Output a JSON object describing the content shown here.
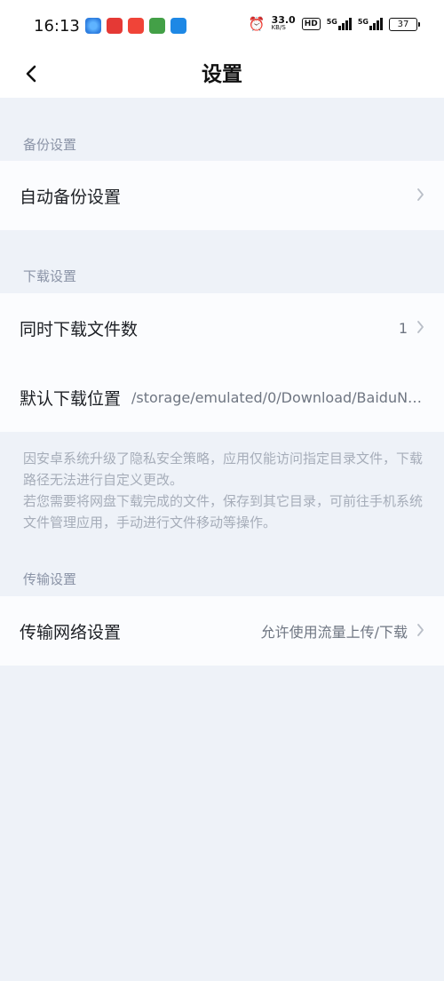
{
  "status_bar": {
    "time": "16:13",
    "speed_value": "33.0",
    "speed_unit": "KB/S",
    "hd_badge": "HD",
    "signal1_label": "5G",
    "signal2_label": "5G",
    "battery": "37"
  },
  "header": {
    "title": "设置"
  },
  "sections": {
    "backup": {
      "label": "备份设置",
      "items": [
        {
          "title": "自动备份设置"
        }
      ]
    },
    "download": {
      "label": "下载设置",
      "items": [
        {
          "title": "同时下载文件数",
          "value": "1"
        },
        {
          "title": "默认下载位置",
          "value": "/storage/emulated/0/Download/BaiduNetdisk"
        }
      ],
      "note_line1": "因安卓系统升级了隐私安全策略，应用仅能访问指定目录文件，下载路径无法进行自定义更改。",
      "note_line2": "若您需要将网盘下载完成的文件，保存到其它目录，可前往手机系统文件管理应用，手动进行文件移动等操作。"
    },
    "transfer": {
      "label": "传输设置",
      "items": [
        {
          "title": "传输网络设置",
          "value": "允许使用流量上传/下载"
        }
      ]
    }
  },
  "icons": {
    "back": "chevron-left-icon",
    "chevron": "chevron-right-icon"
  }
}
